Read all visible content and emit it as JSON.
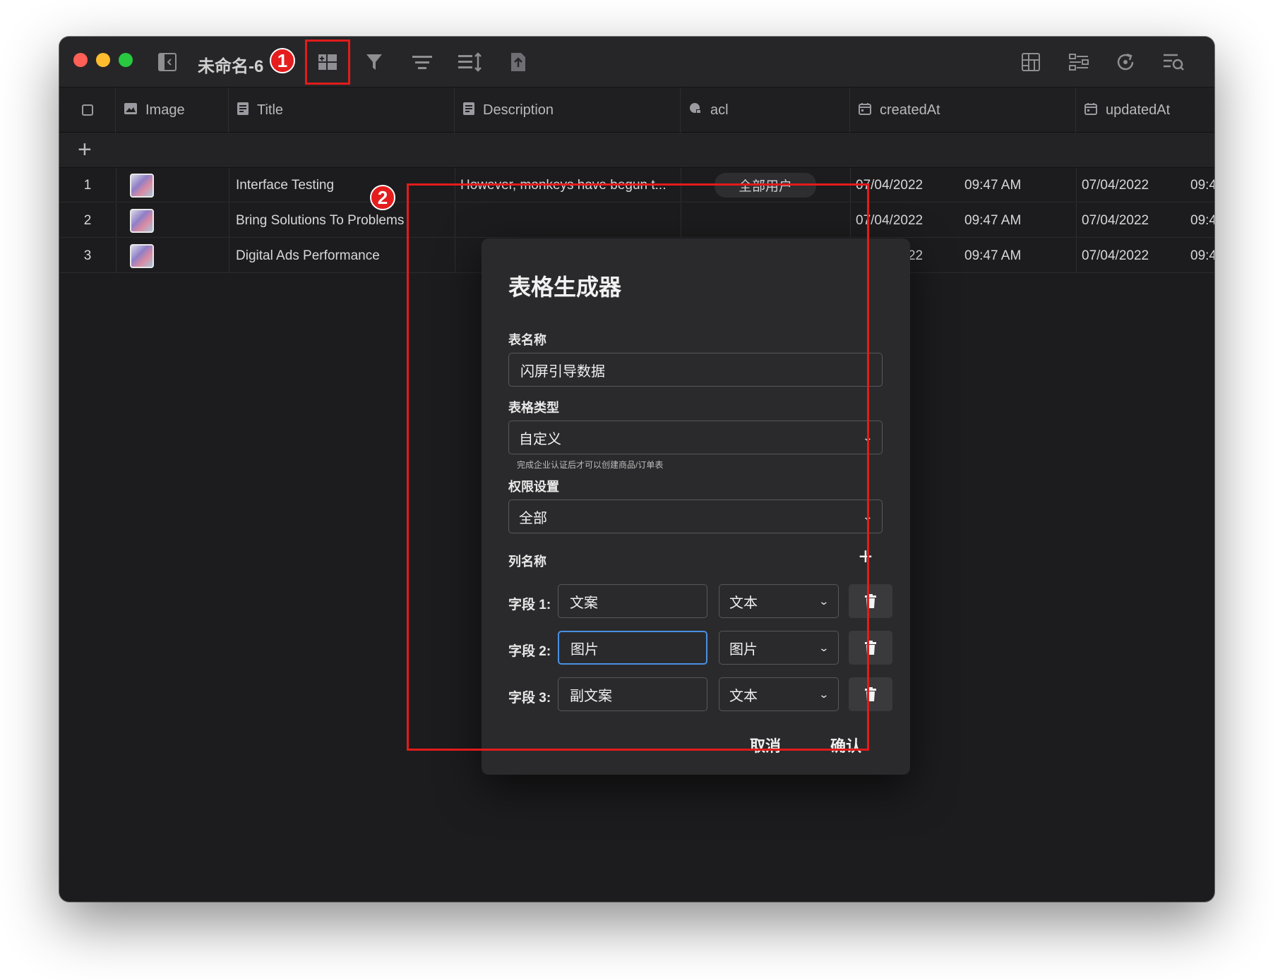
{
  "window": {
    "title": "未命名-6"
  },
  "markers": [
    "1",
    "2"
  ],
  "toolbar": {
    "icons": [
      "sidebar-toggle-icon",
      "table-generator-icon",
      "filter-icon",
      "sort-icon",
      "row-height-icon",
      "export-icon",
      "grid-view-icon",
      "form-view-icon",
      "refresh-icon",
      "search-icon"
    ]
  },
  "table": {
    "columns": [
      {
        "label": "Image",
        "icon": "image-icon"
      },
      {
        "label": "Title",
        "icon": "text-icon"
      },
      {
        "label": "Description",
        "icon": "text-icon"
      },
      {
        "label": "acl",
        "icon": "acl-icon"
      },
      {
        "label": "createdAt",
        "icon": "calendar-icon"
      },
      {
        "label": "updatedAt",
        "icon": "calendar-icon"
      }
    ],
    "rows": [
      {
        "num": "1",
        "title": "Interface Testing",
        "description": "However, monkeys have begun t...",
        "acl": "全部用户",
        "created_date": "07/04/2022",
        "created_time": "09:47 AM",
        "updated_date": "07/04/2022",
        "updated_time": "09:4"
      },
      {
        "num": "2",
        "title": "Bring Solutions To Problems",
        "description": "",
        "acl": "",
        "created_date": "07/04/2022",
        "created_time": "09:47 AM",
        "updated_date": "07/04/2022",
        "updated_time": "09:4"
      },
      {
        "num": "3",
        "title": "Digital Ads Performance",
        "description": "",
        "acl": "",
        "created_date": "07/04/2022",
        "created_time": "09:47 AM",
        "updated_date": "07/04/2022",
        "updated_time": "09:4"
      }
    ]
  },
  "dialog": {
    "title": "表格生成器",
    "name_label": "表名称",
    "name_value": "闪屏引导数据",
    "type_label": "表格类型",
    "type_value": "自定义",
    "type_hint": "完成企业认证后才可以创建商品/订单表",
    "perm_label": "权限设置",
    "perm_value": "全部",
    "columns_label": "列名称",
    "fields": [
      {
        "label": "字段 1:",
        "name": "文案",
        "type": "文本"
      },
      {
        "label": "字段 2:",
        "name": "图片",
        "type": "图片"
      },
      {
        "label": "字段 3:",
        "name": "副文案",
        "type": "文本"
      }
    ],
    "cancel": "取消",
    "confirm": "确认"
  }
}
